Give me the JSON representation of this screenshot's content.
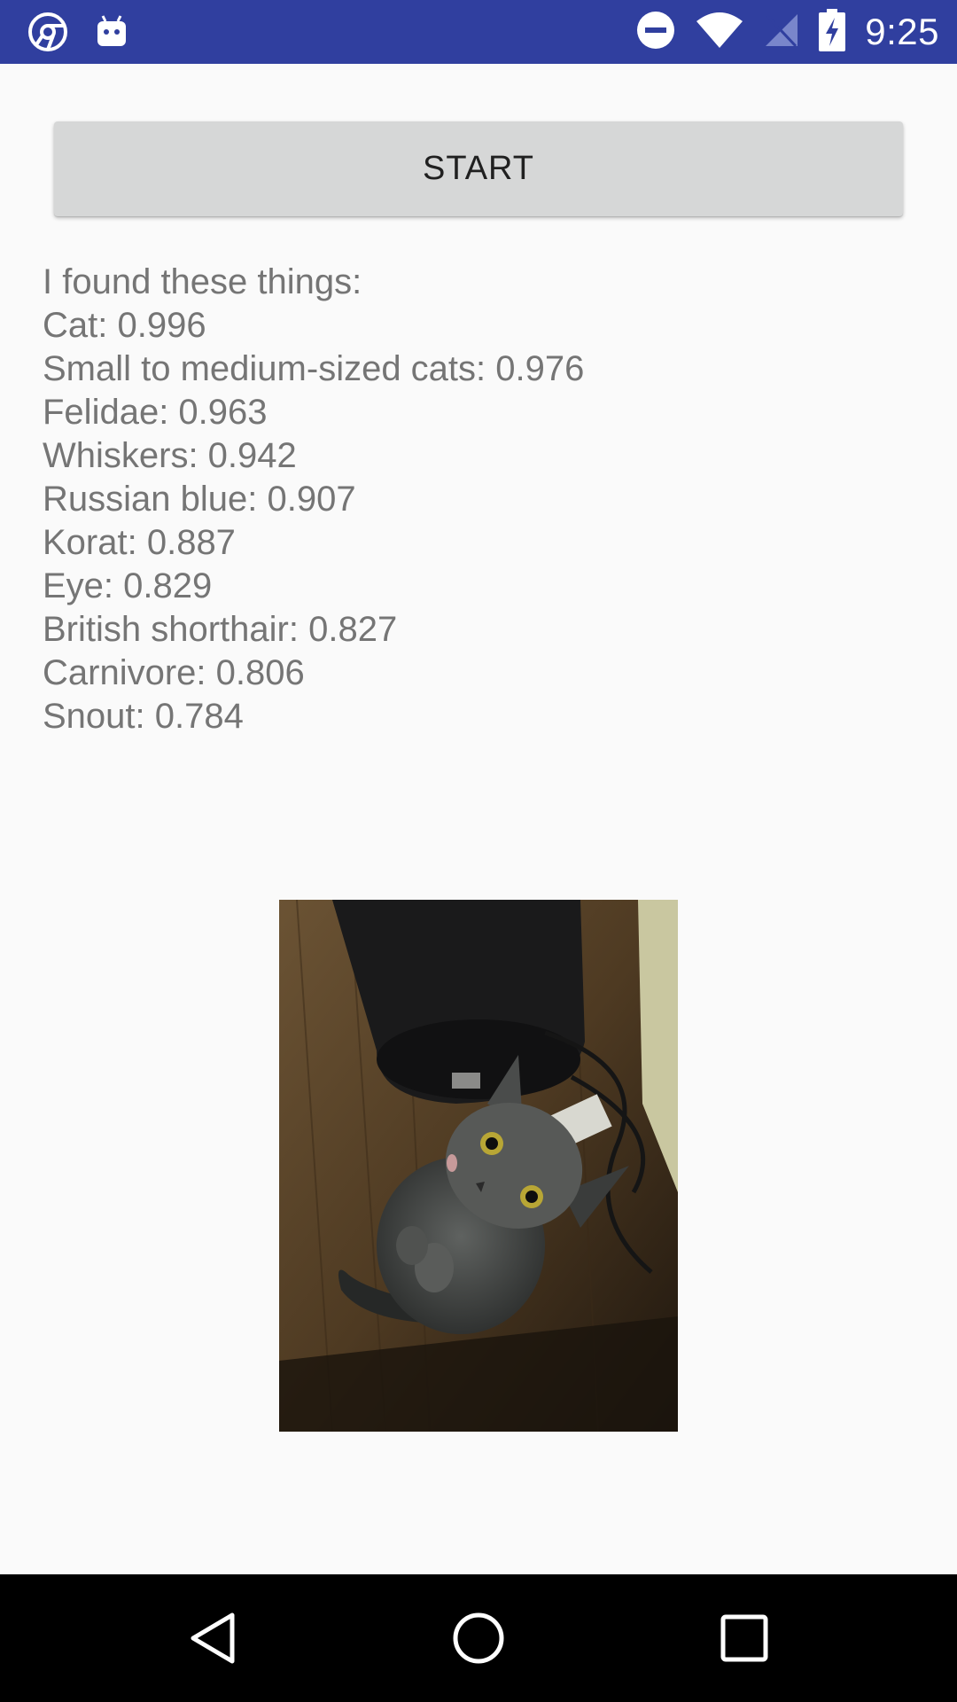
{
  "status_bar": {
    "time": "9:25",
    "icons": [
      "chrome-icon",
      "android-icon",
      "do-not-disturb-icon",
      "wifi-icon",
      "no-signal-icon",
      "battery-charging-icon"
    ],
    "background": "#303f9f"
  },
  "start_button": {
    "label": "START"
  },
  "results": {
    "heading": "I found these things:",
    "items": [
      "Cat: 0.996",
      "Small to medium-sized cats: 0.976",
      "Felidae: 0.963",
      "Whiskers: 0.942",
      "Russian blue: 0.907",
      "Korat: 0.887",
      "Eye: 0.829",
      "British shorthair: 0.827",
      "Carnivore: 0.806",
      "Snout: 0.784"
    ]
  },
  "navigation": {
    "icons": [
      "back-icon",
      "home-icon",
      "recents-icon"
    ]
  }
}
